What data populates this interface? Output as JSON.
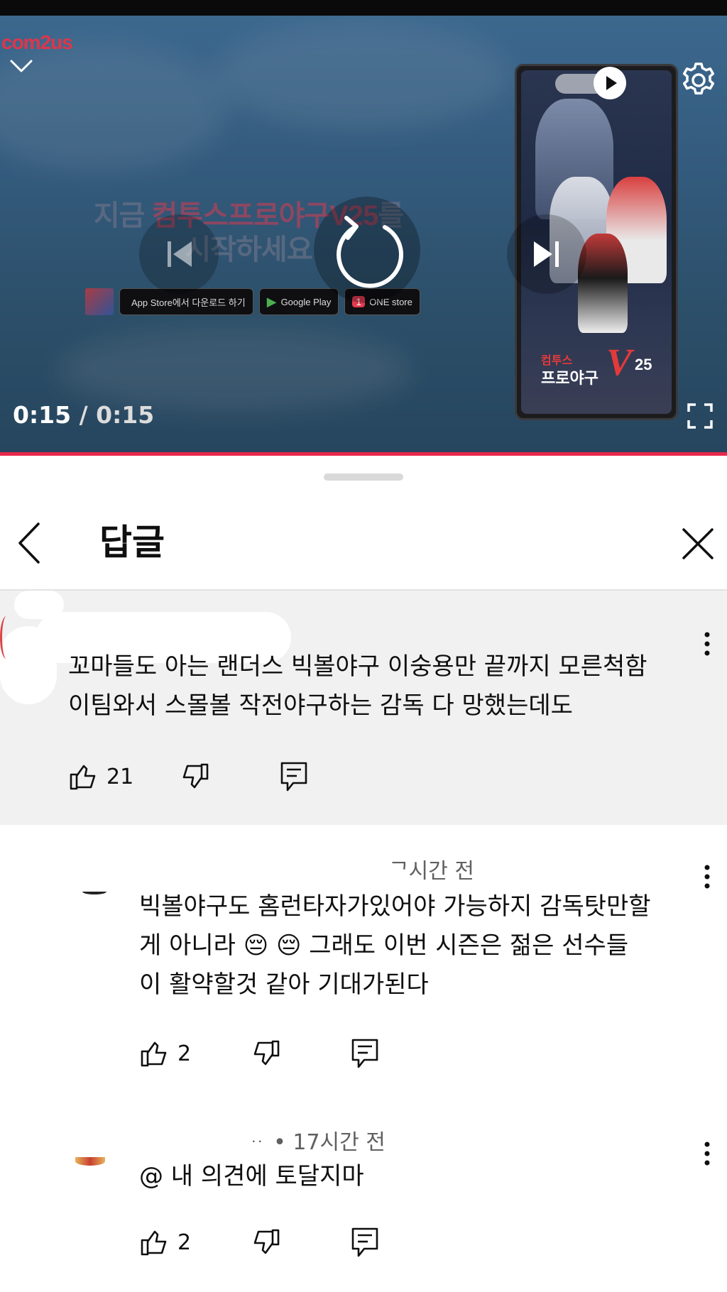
{
  "player": {
    "brand": "com2us",
    "ad_headline_line1_a": "지금 ",
    "ad_headline_line1_b": "컴투스프로야구V25",
    "ad_headline_line1_c": "를",
    "ad_headline_line2": "시작하세요",
    "stores": [
      {
        "icon": "",
        "label": "App Store에서 다운로드 하기"
      },
      {
        "icon": "▶",
        "label": "Google Play"
      },
      {
        "icon": "1",
        "label": "ONE store"
      }
    ],
    "phone_logo_line1": "컴투스",
    "phone_logo_line2": "프로야구",
    "phone_logo_v": "V",
    "phone_logo_25": "25",
    "current_time": "0:15",
    "separator": " / ",
    "duration": "0:15",
    "progress_fraction": 1.0
  },
  "sheet": {
    "title": "답글"
  },
  "parent_comment": {
    "text": "꼬마들도 아는 랜더스 빅볼야구 이숭용만 끝까지 모른척함\n이팀와서 스몰볼 작전야구하는 감독 다 망했는데도",
    "likes": "21"
  },
  "replies": [
    {
      "meta": "ᄀ시간 전",
      "text": "빅볼야구도 홈런타자가있어야 가능하지 감독탓만할\n게 아니라 😔 😔 그래도 이번 시즌은 젊은 선수들\n이 활약할것 같아 기대가된다",
      "likes": "2"
    },
    {
      "meta": "ᆢ • 17시간 전",
      "text": "@ 내 의견에 토달지마",
      "likes": "2"
    }
  ],
  "colors": {
    "progress": "#e8274b",
    "brand": "#e0354a",
    "parent_bg": "#f1f1f1",
    "meta_text": "#606060"
  },
  "icons": [
    "chevron-down-icon",
    "gear-icon",
    "autoplay-toggle-icon",
    "previous-icon",
    "replay-icon",
    "next-icon",
    "fullscreen-icon",
    "back-arrow-icon",
    "close-icon",
    "more-vertical-icon",
    "like-icon",
    "dislike-icon",
    "reply-icon"
  ]
}
